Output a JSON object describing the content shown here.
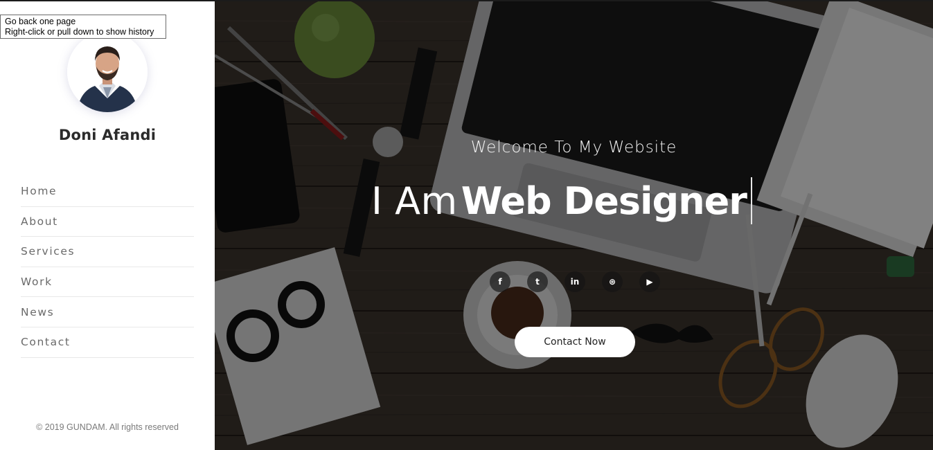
{
  "tooltip": {
    "line1": "Go back one page",
    "line2": "Right-click or pull down to show history"
  },
  "profile": {
    "name": "Doni Afandi"
  },
  "nav": {
    "items": [
      {
        "label": "Home"
      },
      {
        "label": "About"
      },
      {
        "label": "Services"
      },
      {
        "label": "Work"
      },
      {
        "label": "News"
      },
      {
        "label": "Contact"
      }
    ]
  },
  "footer": {
    "copyright": "© 2019 GUNDAM. All rights reserved"
  },
  "hero": {
    "welcome": "Welcome To My Website",
    "headline_light": "I Am",
    "headline_bold": "Web Designer",
    "contact_button": "Contact Now",
    "socials": [
      {
        "icon": "facebook-icon",
        "glyph": "f"
      },
      {
        "icon": "twitter-icon",
        "glyph": "t"
      },
      {
        "icon": "linkedin-icon",
        "glyph": "in"
      },
      {
        "icon": "dribbble-icon",
        "glyph": "⊛"
      },
      {
        "icon": "youtube-icon",
        "glyph": "▶"
      }
    ]
  },
  "colors": {
    "sidebar_bg": "#ffffff",
    "nav_text": "#6a6a6a",
    "hero_overlay": "#000000",
    "button_bg": "#ffffff"
  }
}
